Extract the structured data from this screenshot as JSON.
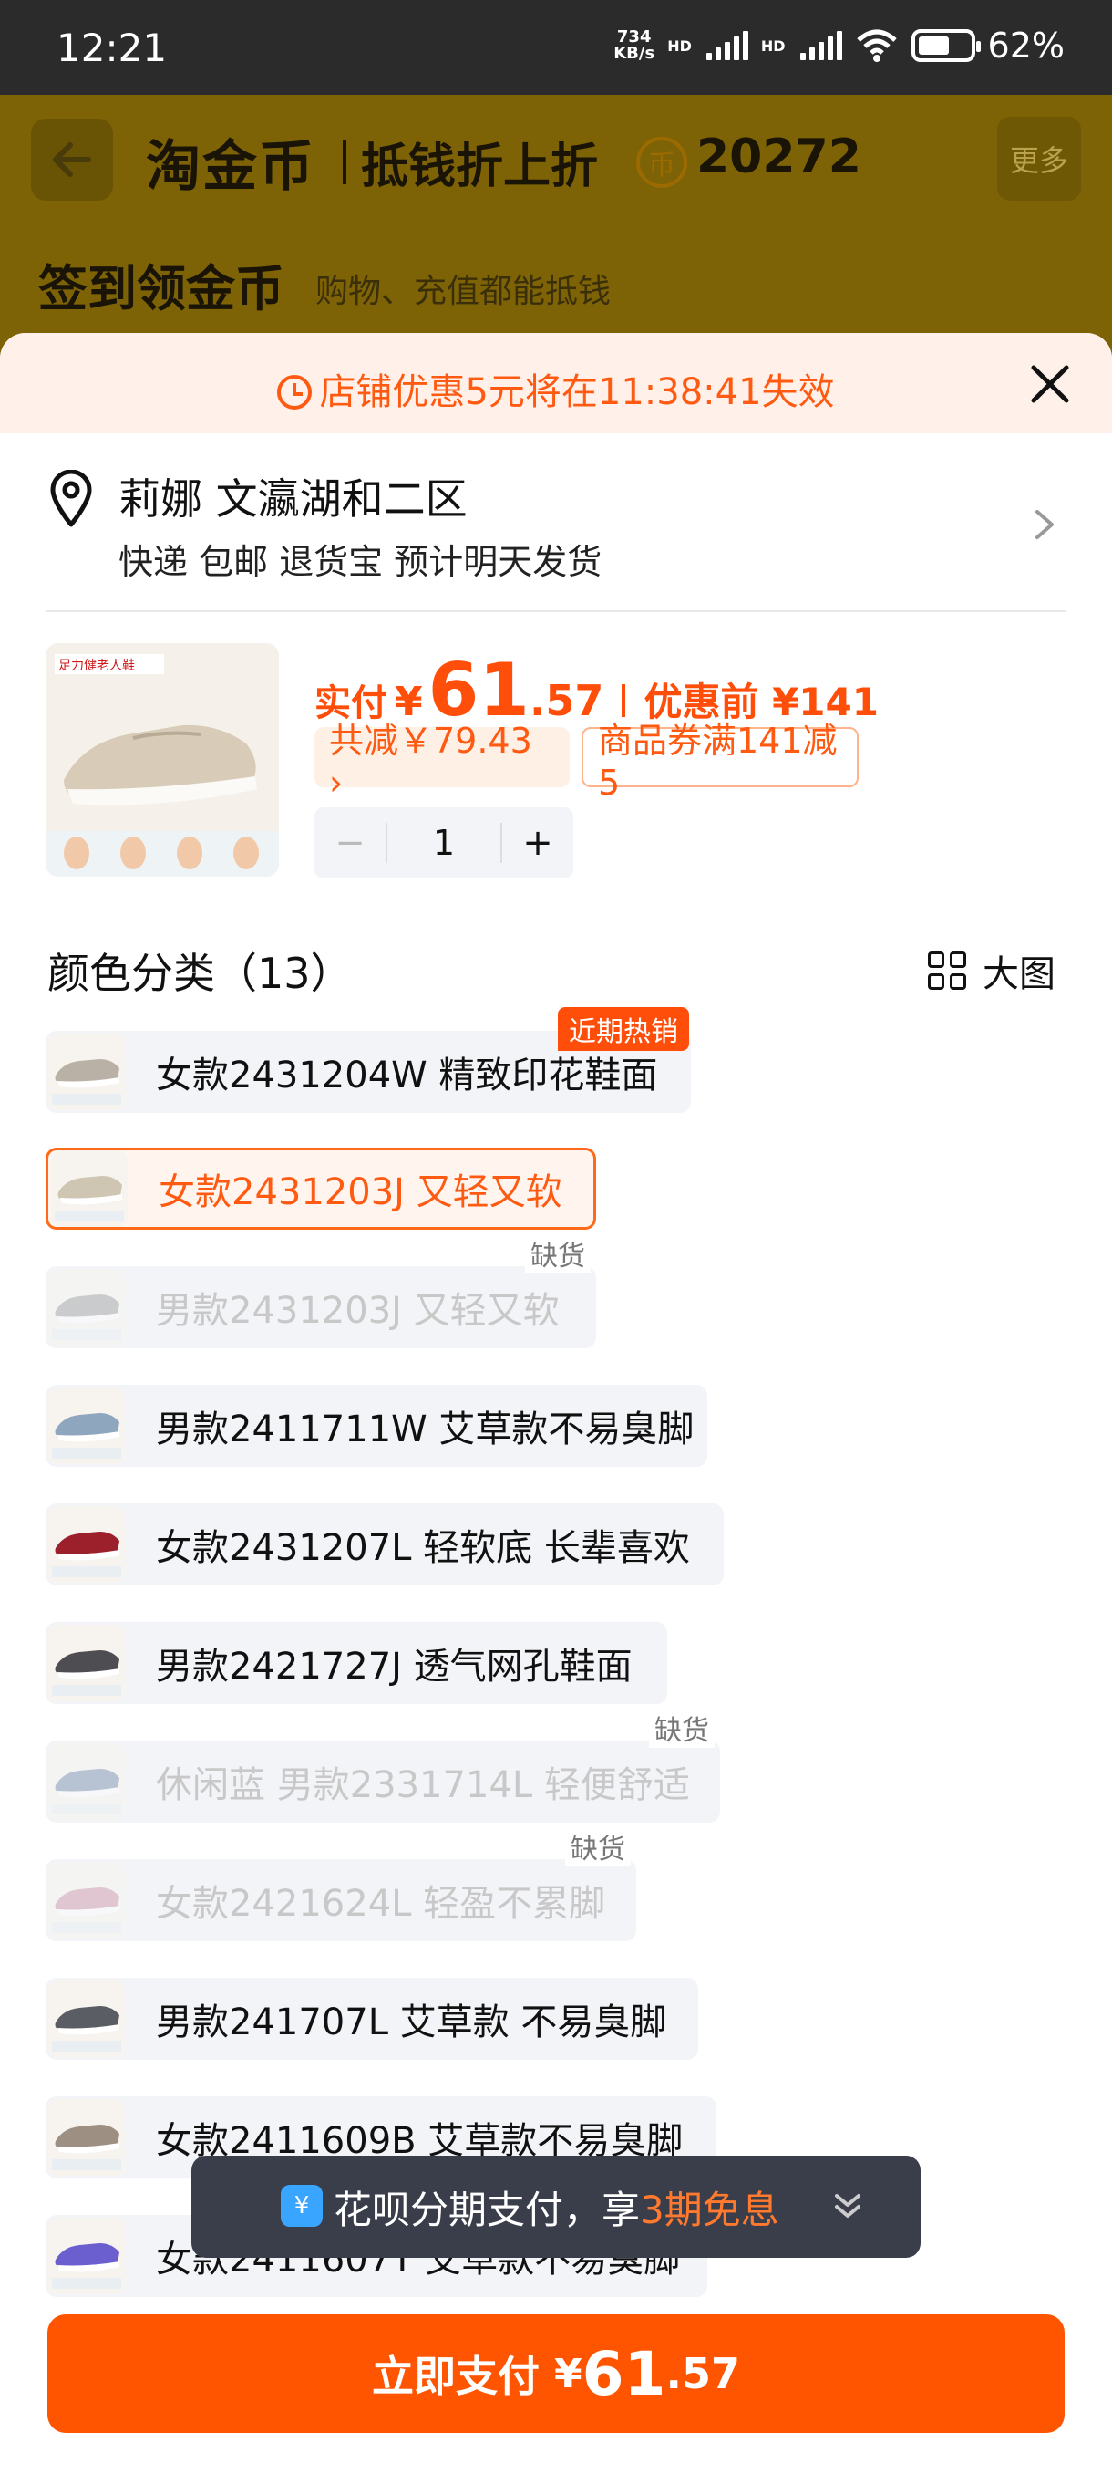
{
  "status_bar": {
    "time": "12:21",
    "net_speed_value": "734",
    "net_speed_unit": "KB/s",
    "hd1": "HD",
    "hd2": "HD",
    "battery": "62%"
  },
  "background_header": {
    "logo": "淘金币",
    "slogan": "抵钱折上折",
    "coin_symbol": "币",
    "coin_amount": "20272",
    "more": "更多",
    "title": "签到领金币",
    "subtitle": "购物、充值都能抵钱"
  },
  "promo": {
    "text": "店铺优惠5元将在11:38:41失效"
  },
  "address": {
    "name_line": "莉娜 文瀛湖和二区",
    "info_line": "快递 包邮 退货宝 预计明天发货"
  },
  "product": {
    "brand_label": "足力健老人鞋",
    "price_label": "实付",
    "currency": "¥",
    "price_int": "61",
    "price_dec": ".57",
    "original_label": "优惠前 ¥141",
    "saving_tag": "共减￥79.43 ›",
    "coupon_tag": "商品券满141减5",
    "quantity_minus": "−",
    "quantity": "1",
    "quantity_plus": "+"
  },
  "variants_section": {
    "title": "颜色分类（13）",
    "big_view": "大图"
  },
  "variants": [
    {
      "label": "女款2431204W 精致印花鞋面",
      "badge": "近期热销",
      "state": "normal",
      "color": "#b9b1a6"
    },
    {
      "label": "女款2431203J 又轻又软",
      "badge": "",
      "state": "selected",
      "color": "#cfc5b3"
    },
    {
      "label": "男款2431203J 又轻又软",
      "badge": "缺货",
      "state": "disabled",
      "color": "#9a9a9a"
    },
    {
      "label": "男款2411711W 艾草款不易臭脚",
      "badge": "",
      "state": "normal",
      "color": "#8fa6bf"
    },
    {
      "label": "女款2431207L 轻软底 长辈喜欢",
      "badge": "",
      "state": "normal",
      "color": "#9c1f2c"
    },
    {
      "label": "男款2421727J 透气网孔鞋面",
      "badge": "",
      "state": "normal",
      "color": "#4d4d52"
    },
    {
      "label": "休闲蓝 男款2331714L 轻便舒适",
      "badge": "缺货",
      "state": "disabled",
      "color": "#6f86a8"
    },
    {
      "label": "女款2421624L 轻盈不累脚",
      "badge": "缺货",
      "state": "disabled",
      "color": "#c98fa4"
    },
    {
      "label": "男款241707L 艾草款 不易臭脚",
      "badge": "",
      "state": "normal",
      "color": "#5a5d63"
    },
    {
      "label": "女款2411609B 艾草款不易臭脚",
      "badge": "",
      "state": "normal",
      "color": "#9d8f82"
    },
    {
      "label": "女款2411607T 艾草款不易臭脚",
      "badge": "",
      "state": "normal",
      "color": "#6b5fd0"
    }
  ],
  "toast": {
    "icon_symbol": "¥",
    "text_prefix": "花呗分期支付，享",
    "text_highlight": "3期免息"
  },
  "pay_button": {
    "label": "立即支付",
    "currency": "¥",
    "amount_int": "61",
    "amount_dec": ".57"
  },
  "colors": {
    "accent": "#ff5500",
    "header_dimmed": "#7e6306",
    "promo_bg": "#fff1ea"
  }
}
